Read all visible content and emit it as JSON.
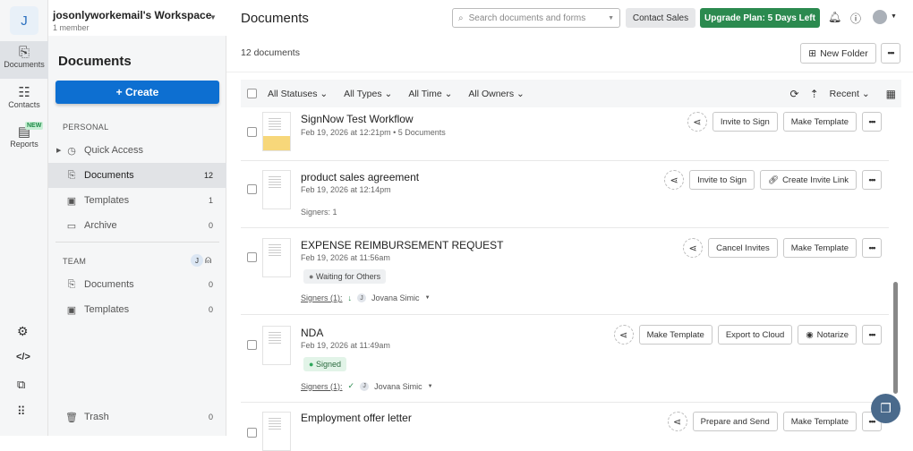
{
  "workspace": {
    "initial": "J",
    "name": "josonlyworkemail's Workspace",
    "members": "1 member"
  },
  "rail": {
    "documents": "Documents",
    "contacts": "Contacts",
    "reports": "Reports",
    "new_badge": "NEW"
  },
  "sidebar": {
    "title": "Documents",
    "create": "+ Create",
    "personal": "PERSONAL",
    "team": "TEAM",
    "team_avatar": "J",
    "personal_items": [
      {
        "label": "Quick Access",
        "count": ""
      },
      {
        "label": "Documents",
        "count": "12"
      },
      {
        "label": "Templates",
        "count": "1"
      },
      {
        "label": "Archive",
        "count": "0"
      }
    ],
    "team_items": [
      {
        "label": "Documents",
        "count": "0"
      },
      {
        "label": "Templates",
        "count": "0"
      }
    ],
    "trash": {
      "label": "Trash",
      "count": "0"
    }
  },
  "header": {
    "title": "Documents",
    "search_placeholder": "Search documents and forms",
    "contact_sales": "Contact Sales",
    "upgrade": "Upgrade Plan: 5 Days Left"
  },
  "toolbar": {
    "count": "12 documents",
    "new_folder": "New Folder",
    "filters": [
      "All Statuses",
      "All Types",
      "All Time",
      "All Owners"
    ],
    "sort": "Recent"
  },
  "docs": [
    {
      "title": "SignNow Test Workflow",
      "meta": "Feb 19, 2026 at 12:21pm • 5 Documents",
      "actions": [
        "Invite to Sign",
        "Make Template"
      ]
    },
    {
      "title": "product sales agreement",
      "meta": "Feb 19, 2026 at 12:14pm",
      "signers": "Signers: 1",
      "actions": [
        "Invite to Sign",
        "Create Invite Link"
      ]
    },
    {
      "title": "EXPENSE REIMBURSEMENT REQUEST",
      "meta": "Feb 19, 2026 at 11:56am",
      "status": "Waiting for Others",
      "signers_label": "Signers (1):",
      "signer_initial": "J",
      "signer": "Jovana Simic",
      "actions": [
        "Cancel Invites",
        "Make Template"
      ]
    },
    {
      "title": "NDA",
      "meta": "Feb 19, 2026 at 11:49am",
      "status": "Signed",
      "signers_label": "Signers (1):",
      "signer_initial": "J",
      "signer": "Jovana Simic",
      "actions": [
        "Make Template",
        "Export to Cloud",
        "Notarize"
      ]
    },
    {
      "title": "Employment offer letter",
      "actions": [
        "Prepare and Send",
        "Make Template"
      ]
    }
  ],
  "colors": {
    "primary": "#0d6fd1",
    "upgrade": "#2b8a4f"
  }
}
